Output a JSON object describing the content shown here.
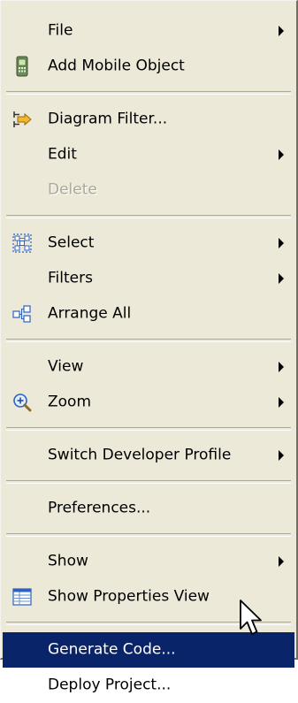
{
  "menu": {
    "items": [
      {
        "label": "File",
        "icon": "",
        "submenu": true,
        "disabled": false
      },
      {
        "label": "Add Mobile Object",
        "icon": "mobile-phone-icon",
        "submenu": false,
        "disabled": false
      },
      {
        "label": "Diagram Filter...",
        "icon": "diagram-filter-icon",
        "submenu": false,
        "disabled": false
      },
      {
        "label": "Edit",
        "icon": "",
        "submenu": true,
        "disabled": false
      },
      {
        "label": "Delete",
        "icon": "",
        "submenu": false,
        "disabled": true
      },
      {
        "label": "Select",
        "icon": "select-icon",
        "submenu": true,
        "disabled": false
      },
      {
        "label": "Filters",
        "icon": "",
        "submenu": true,
        "disabled": false
      },
      {
        "label": "Arrange All",
        "icon": "arrange-all-icon",
        "submenu": false,
        "disabled": false
      },
      {
        "label": "View",
        "icon": "",
        "submenu": true,
        "disabled": false
      },
      {
        "label": "Zoom",
        "icon": "zoom-icon",
        "submenu": true,
        "disabled": false
      },
      {
        "label": "Switch Developer Profile",
        "icon": "",
        "submenu": true,
        "disabled": false
      },
      {
        "label": "Preferences...",
        "icon": "",
        "submenu": false,
        "disabled": false
      },
      {
        "label": "Show",
        "icon": "",
        "submenu": true,
        "disabled": false
      },
      {
        "label": "Show Properties View",
        "icon": "properties-view-icon",
        "submenu": false,
        "disabled": false
      },
      {
        "label": "Generate Code...",
        "icon": "",
        "submenu": false,
        "disabled": false,
        "highlighted": true
      },
      {
        "label": "Deploy Project...",
        "icon": "",
        "submenu": false,
        "disabled": false
      }
    ]
  },
  "colors": {
    "menu_background": "#ece9d8",
    "highlight_background": "#0a246a",
    "highlight_text": "#ffffff",
    "disabled_text": "#aca899"
  },
  "cursor": {
    "icon": "mouse-pointer-icon"
  }
}
